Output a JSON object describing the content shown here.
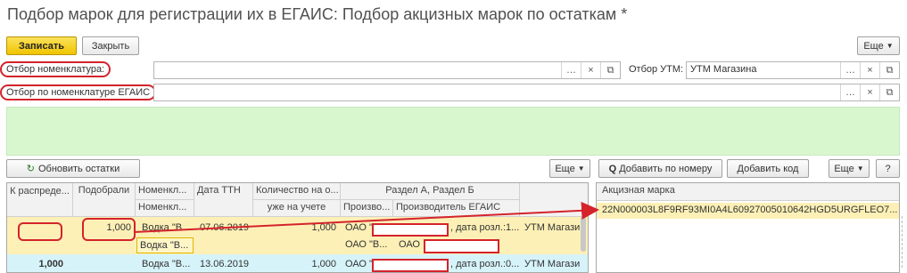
{
  "window": {
    "title": "Подбор марок для регистрации их в ЕГАИС: Подбор акцизных марок по остаткам *"
  },
  "toolbar": {
    "save_label": "Записать",
    "close_label": "Закрыть",
    "more_label": "Еще"
  },
  "filters": {
    "nomenclature_label": "Отбор номенклатура:",
    "nomenclature_value": "",
    "egais_label": "Отбор по номенклатуре ЕГАИС",
    "egais_value": "",
    "utm_label": "Отбор УТМ:",
    "utm_value": "УТМ Магазина"
  },
  "left_panel": {
    "refresh_label": "Обновить остатки",
    "more_label": "Еще",
    "columns": {
      "to_distribute": "К распреде...",
      "selected": "Подобрали",
      "nomenclature": "Номенкл...",
      "date_ttn": "Дата ТТН",
      "quantity": "Количество на о...",
      "quantity_sub": "уже на учете",
      "section": "Раздел А, Раздел Б",
      "producer": "Произво...",
      "producer_egais": "Производитель ЕГАИС"
    },
    "rows": [
      {
        "to_distribute": "",
        "selected": "1,000",
        "nomenclature": "Водка \"В...",
        "nomenclature2": "Водка \"В...",
        "date": "07.06.2019",
        "quantity": "1,000",
        "producer": "ОАО \"",
        "producer2": "ОАО \"В...",
        "producer_egais2": "ОАО",
        "section": ", дата розл.:1...",
        "utm": "УТМ Магази"
      },
      {
        "to_distribute": "1,000",
        "selected": "",
        "nomenclature": "Водка \"В...",
        "date": "13.06.2019",
        "quantity": "1,000",
        "producer": "ОАО \"",
        "section": ", дата розл.:0...",
        "utm": "УТМ Магази"
      }
    ]
  },
  "right_panel": {
    "add_by_number_label": "Добавить по номеру",
    "add_code_label": "Добавить код",
    "more_label": "Еще",
    "help_label": "?",
    "column_header": "Акцизная марка",
    "rows": [
      {
        "mark": "22N000003L8F9RF93MI0A4L60927005010642HGD5URGFLEO7..."
      }
    ]
  },
  "colors": {
    "accent": "#f0c400",
    "highlight_row": "#fdf0b6",
    "annotation_red": "#d4232b",
    "filter_area": "#d9f7cf"
  }
}
